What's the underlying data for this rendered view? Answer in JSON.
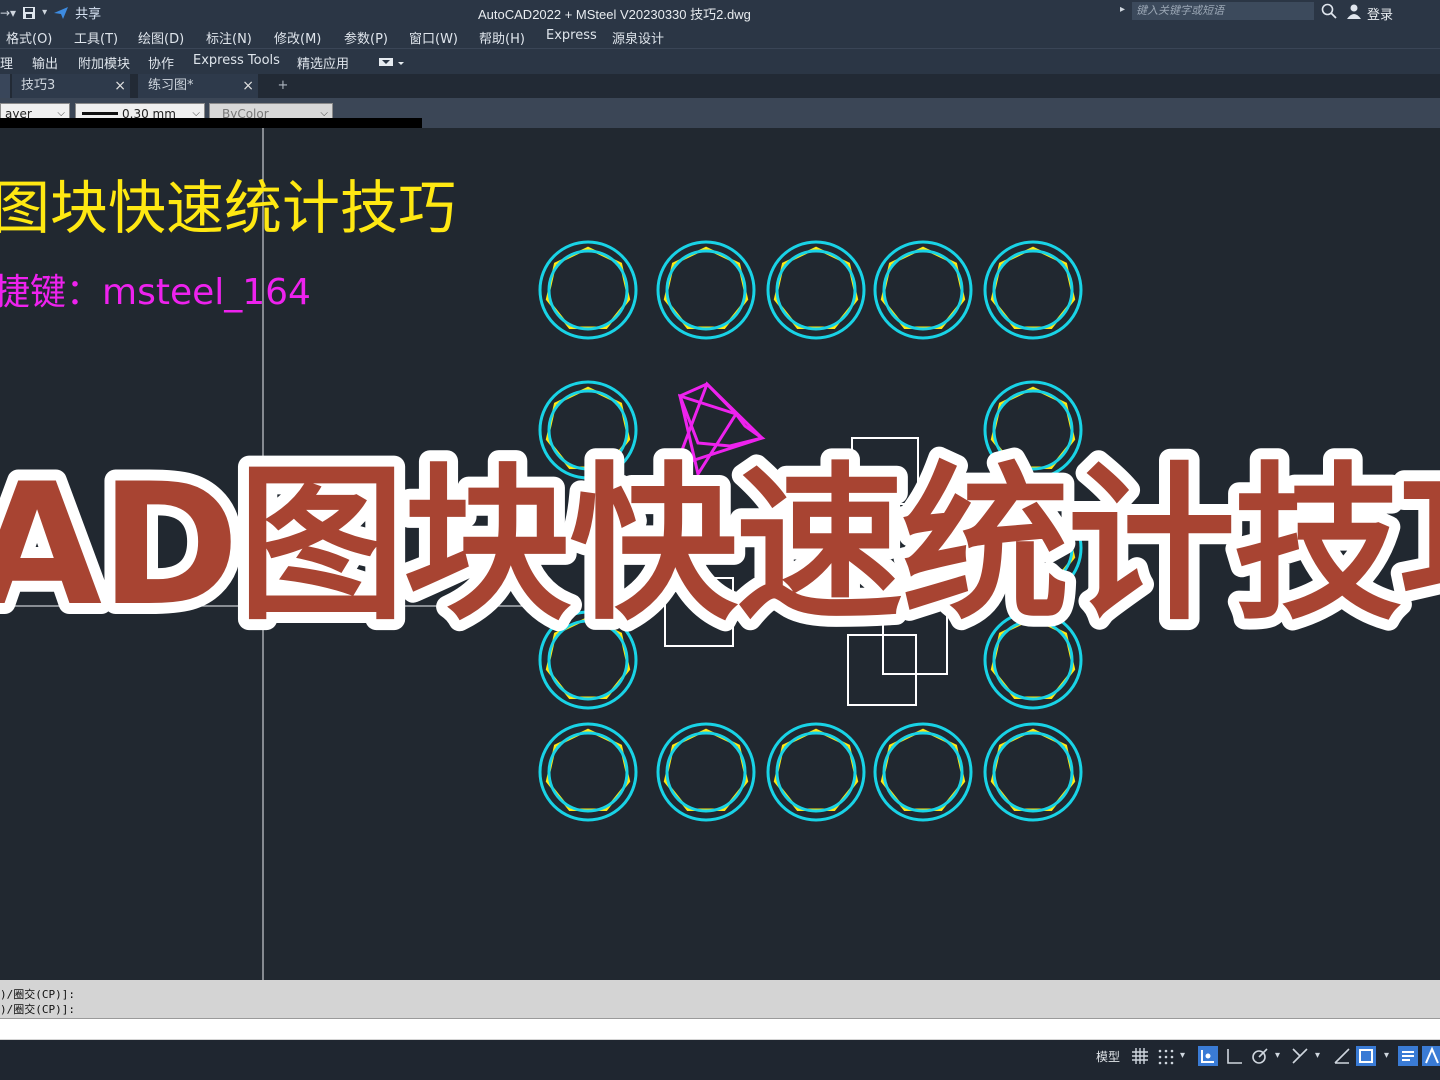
{
  "titlebar": {
    "share": "共享",
    "title": "AutoCAD2022 + MSteel V20230330    技巧2.dwg",
    "search_placeholder": "键入关键字或短语",
    "login": "登录"
  },
  "menu": [
    "格式(O)",
    "工具(T)",
    "绘图(D)",
    "标注(N)",
    "修改(M)",
    "参数(P)",
    "窗口(W)",
    "帮助(H)",
    "Express",
    "源泉设计"
  ],
  "ribbon": [
    "理",
    "输出",
    "附加模块",
    "协作",
    "Express Tools",
    "精选应用"
  ],
  "tabs": [
    {
      "label": "技巧3",
      "close": "×"
    },
    {
      "label": "练习图*",
      "close": "×"
    }
  ],
  "tab_add": "+",
  "props": {
    "layer": "ayer",
    "lineweight": "0.30 mm",
    "color": "ByColor"
  },
  "drawing": {
    "heading": "图块快速统计技巧",
    "shortcut": "捷键：msteel_164"
  },
  "overlay_title": "AD图块快速统计技巧",
  "command": {
    "line1": ")/圈交(CP)]:",
    "line2": ")/圈交(CP)]:"
  },
  "status": {
    "model": "模型"
  },
  "colors": {
    "canvas": "#212830",
    "cyan": "#19d3e6",
    "yellow": "#ffe812",
    "magenta": "#ee22ee",
    "white": "#ffffff",
    "banner_red": "#a84432"
  }
}
